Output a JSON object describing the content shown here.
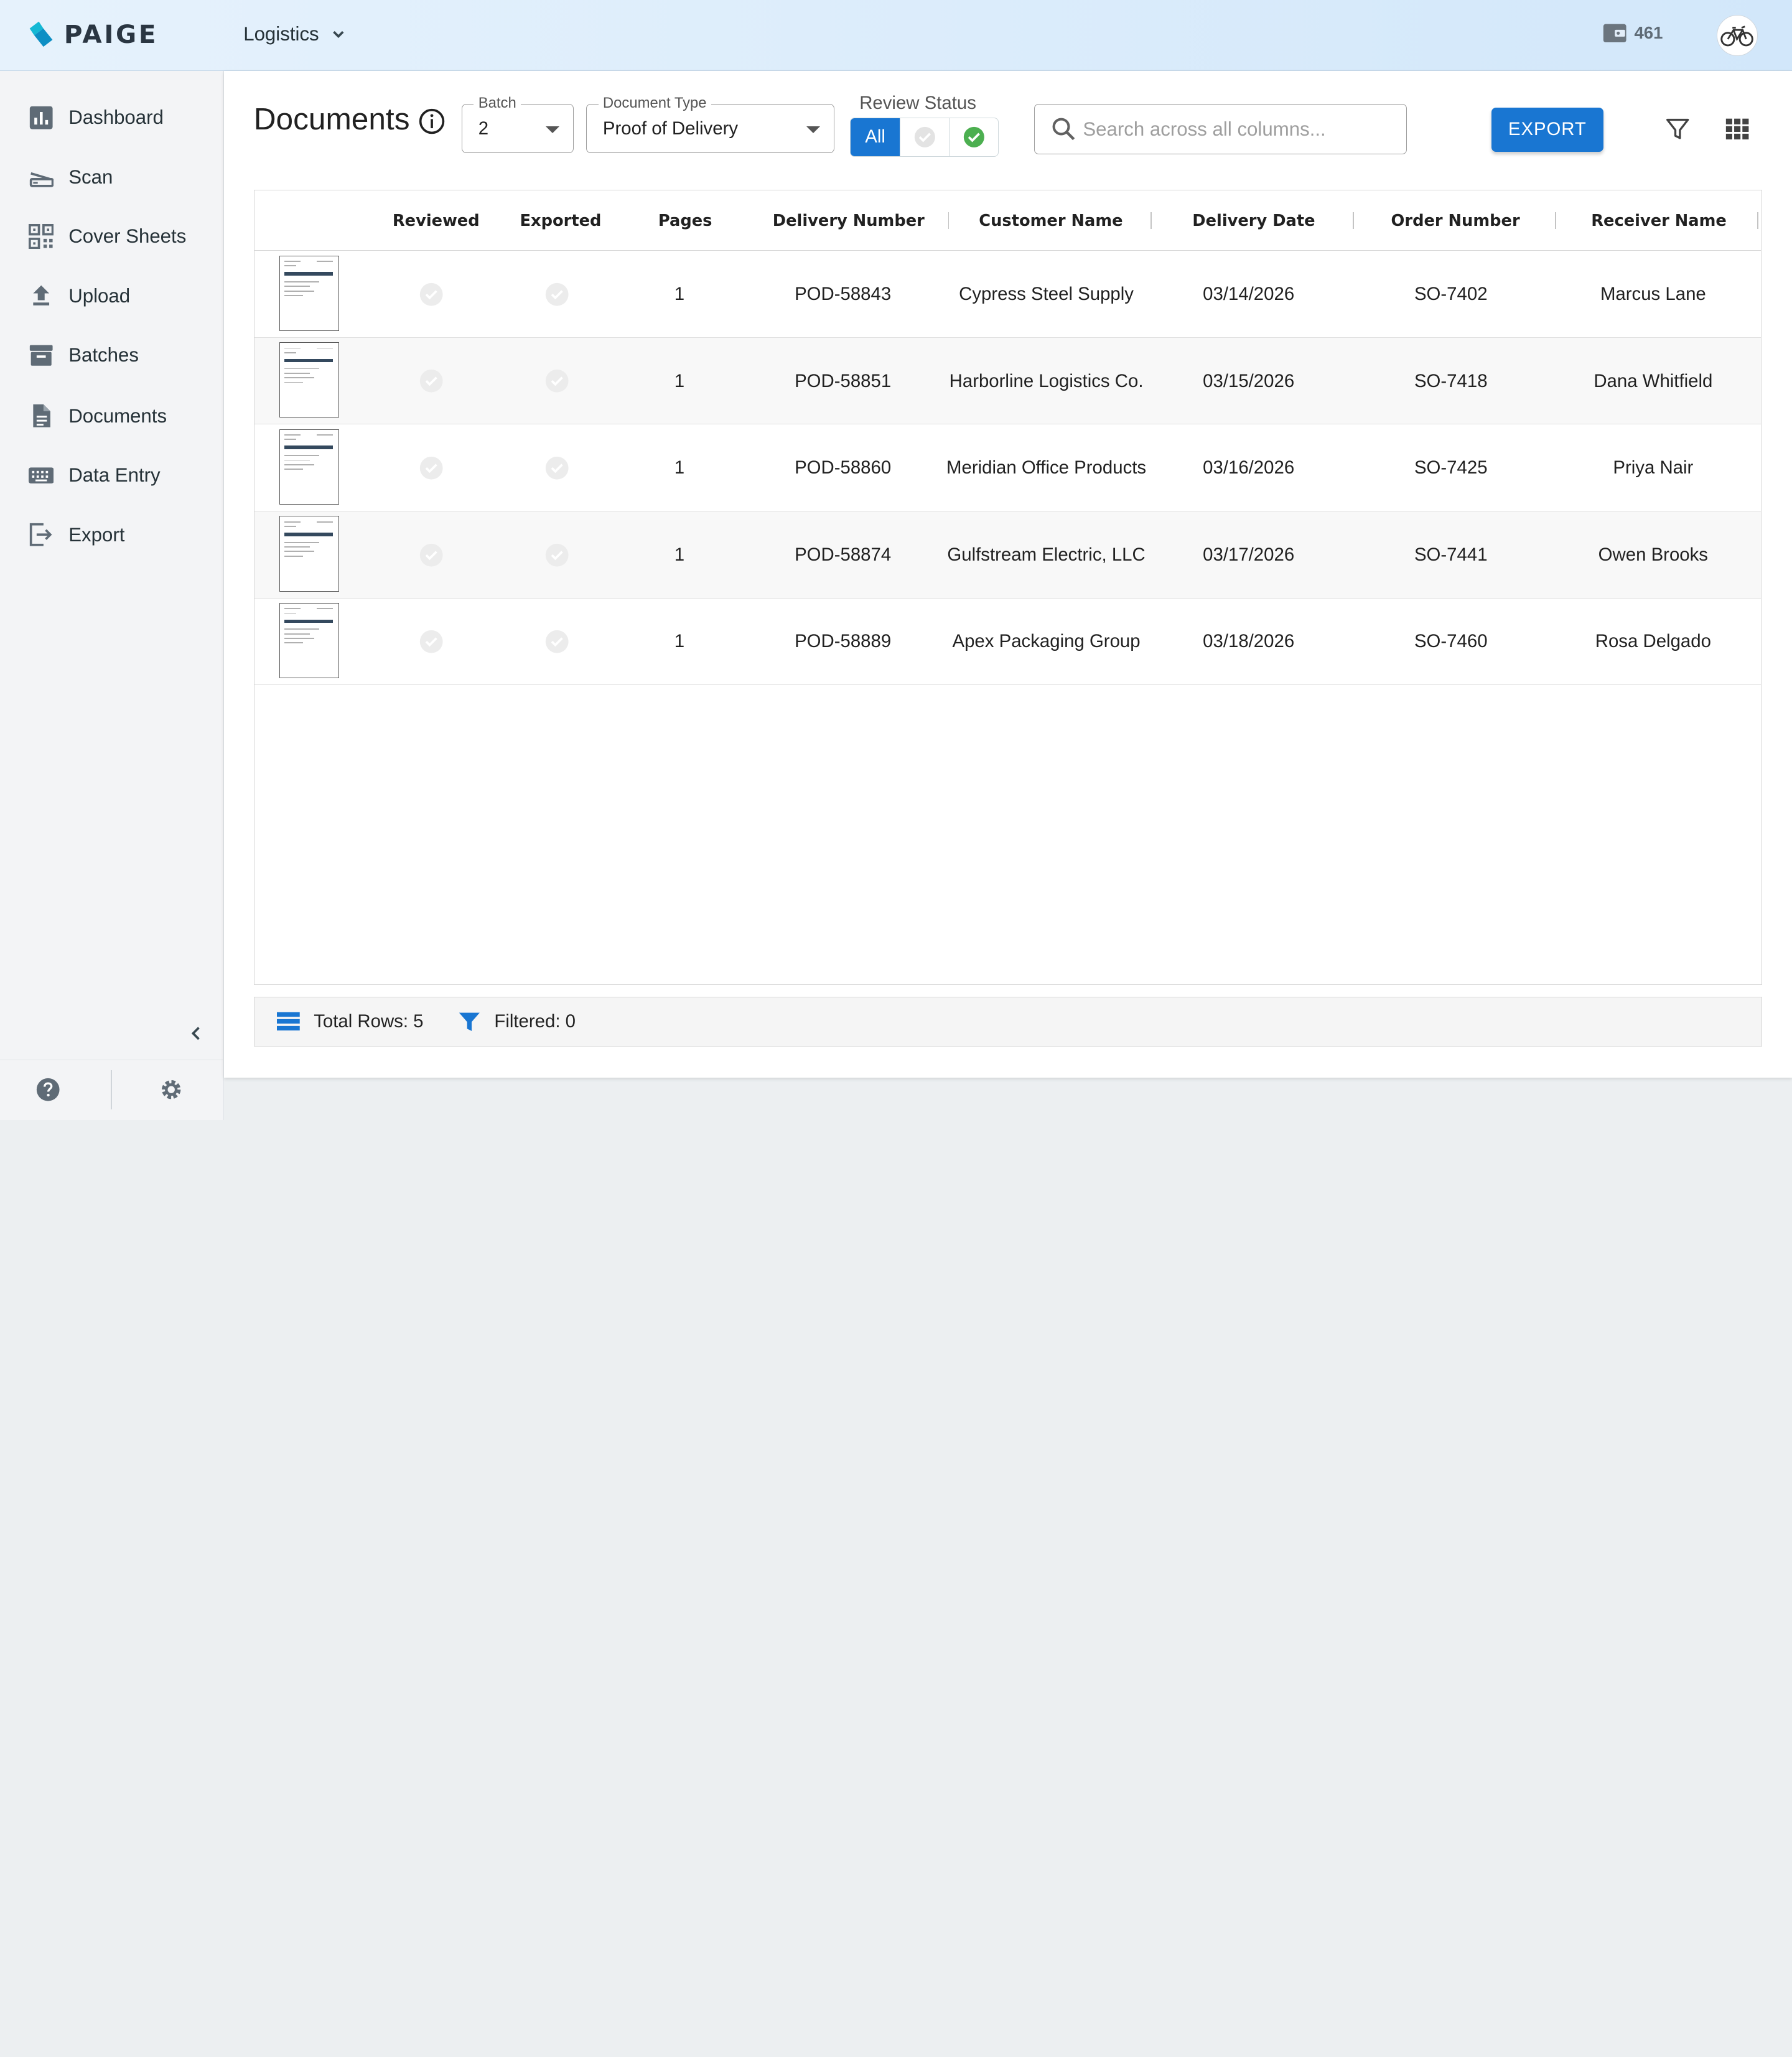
{
  "app": {
    "logo_text": "PAIGE"
  },
  "topbar": {
    "workspace": "Logistics",
    "credits": "461"
  },
  "sidebar": {
    "items": [
      {
        "label": "Dashboard",
        "icon": "bar-chart-icon"
      },
      {
        "label": "Scan",
        "icon": "scanner-icon"
      },
      {
        "label": "Cover Sheets",
        "icon": "qr-code-icon"
      },
      {
        "label": "Upload",
        "icon": "upload-icon"
      },
      {
        "label": "Batches",
        "icon": "archive-box-icon"
      },
      {
        "label": "Documents",
        "icon": "document-icon"
      },
      {
        "label": "Data Entry",
        "icon": "keyboard-icon"
      },
      {
        "label": "Export",
        "icon": "export-icon"
      }
    ]
  },
  "page": {
    "title": "Documents"
  },
  "filters": {
    "batch_label": "Batch",
    "batch_value": "2",
    "doctype_label": "Document Type",
    "doctype_value": "Proof of Delivery",
    "review_label": "Review Status",
    "review_options": [
      "All",
      "unreviewed",
      "reviewed"
    ],
    "review_selected": "All",
    "search_placeholder": "Search across all columns...",
    "export_label": "EXPORT"
  },
  "table": {
    "columns": [
      "Reviewed",
      "Exported",
      "Pages",
      "Delivery Number",
      "Customer Name",
      "Delivery Date",
      "Order Number",
      "Receiver Name"
    ],
    "rows": [
      {
        "pages": "1",
        "delivery_number": "POD-58843",
        "customer": "Cypress Steel Supply",
        "date": "03/14/2026",
        "order": "SO-7402",
        "receiver": "Marcus Lane"
      },
      {
        "pages": "1",
        "delivery_number": "POD-58851",
        "customer": "Harborline Logistics Co.",
        "date": "03/15/2026",
        "order": "SO-7418",
        "receiver": "Dana Whitfield"
      },
      {
        "pages": "1",
        "delivery_number": "POD-58860",
        "customer": "Meridian Office Products",
        "date": "03/16/2026",
        "order": "SO-7425",
        "receiver": "Priya Nair"
      },
      {
        "pages": "1",
        "delivery_number": "POD-58874",
        "customer": "Gulfstream Electric, LLC",
        "date": "03/17/2026",
        "order": "SO-7441",
        "receiver": "Owen Brooks"
      },
      {
        "pages": "1",
        "delivery_number": "POD-58889",
        "customer": "Apex Packaging Group",
        "date": "03/18/2026",
        "order": "SO-7460",
        "receiver": "Rosa Delgado"
      }
    ]
  },
  "footer": {
    "total_rows": "Total Rows: 5",
    "filtered": "Filtered: 0"
  },
  "colors": {
    "accent": "#1976d2",
    "check_green": "#4caf50",
    "check_grey": "#e0e0e0",
    "logo_cyan": "#14b8d4"
  }
}
